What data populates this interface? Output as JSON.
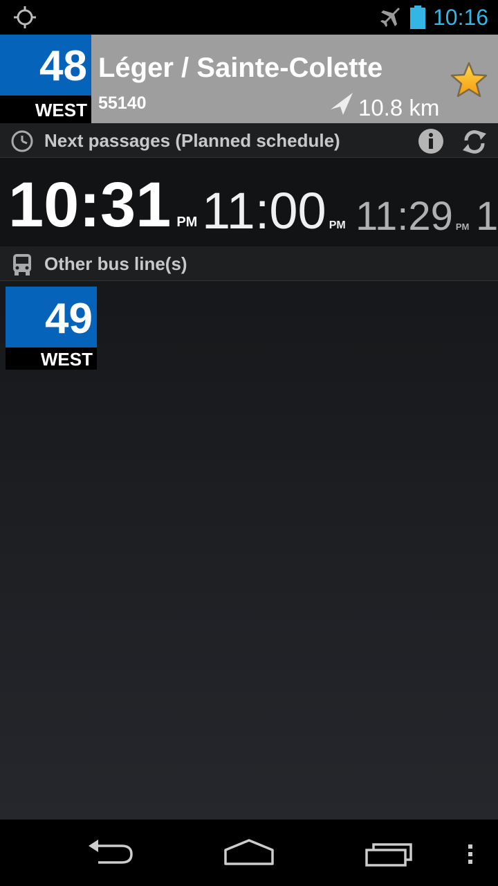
{
  "status_bar": {
    "time": "10:16",
    "icons": [
      "gps-icon",
      "airplane-mode-icon",
      "battery-icon"
    ],
    "time_color": "#33b5e5"
  },
  "header": {
    "route_number": "48",
    "route_direction": "WEST",
    "stop_name": "Léger / Sainte-Colette",
    "stop_code": "55140",
    "distance": "10.8 km",
    "favorite": true,
    "route_color": "#0563ba"
  },
  "next_passages": {
    "label": "Next passages (Planned schedule)",
    "icons": [
      "clock-icon",
      "info-icon",
      "refresh-icon"
    ],
    "times": [
      {
        "time": "10:31",
        "ampm": "PM"
      },
      {
        "time": "11:00",
        "ampm": "PM"
      },
      {
        "time": "11:29",
        "ampm": "PM"
      },
      {
        "time": "1",
        "ampm": ""
      }
    ]
  },
  "other_lines": {
    "label": "Other bus line(s)",
    "icon": "bus-icon",
    "lines": [
      {
        "number": "49",
        "direction": "WEST"
      }
    ]
  },
  "nav_bar": {
    "buttons": [
      "back-icon",
      "home-icon",
      "recent-apps-icon",
      "menu-icon"
    ]
  }
}
